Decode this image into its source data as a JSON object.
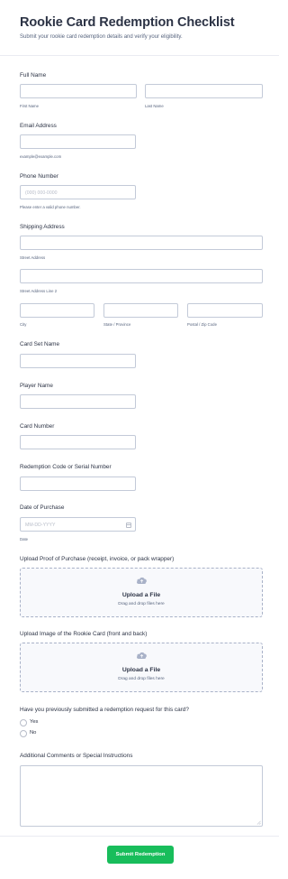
{
  "form": {
    "title": "Rookie Card Redemption Checklist",
    "subtitle": "Submit your rookie card redemption details and verify your eligibility."
  },
  "full_name": {
    "label": "Full Name",
    "first_sub": "First Name",
    "last_sub": "Last Name",
    "first_value": "",
    "last_value": ""
  },
  "email": {
    "label": "Email Address",
    "sub": "example@example.com",
    "value": ""
  },
  "phone": {
    "label": "Phone Number",
    "placeholder": "(000) 000-0000",
    "sub": "Please enter a valid phone number.",
    "value": ""
  },
  "shipping": {
    "label": "Shipping Address",
    "street_sub": "Street Address",
    "street2_sub": "Street Address Line 2",
    "city_sub": "City",
    "state_sub": "State / Province",
    "postal_sub": "Postal / Zip Code"
  },
  "card_set": {
    "label": "Card Set Name",
    "value": ""
  },
  "player": {
    "label": "Player Name",
    "value": ""
  },
  "card_number": {
    "label": "Card Number",
    "value": ""
  },
  "redemption_code": {
    "label": "Redemption Code or Serial Number",
    "value": ""
  },
  "purchase_date": {
    "label": "Date of Purchase",
    "placeholder": "MM-DD-YYYY",
    "sub": "Date",
    "icon": "calendar-icon"
  },
  "upload_proof": {
    "label": "Upload Proof of Purchase (receipt, invoice, or pack wrapper)",
    "title": "Upload a File",
    "sub": "Drag and drop files here",
    "icon": "cloud-upload-icon"
  },
  "upload_card": {
    "label": "Upload Image of the Rookie Card (front and back)",
    "title": "Upload a File",
    "sub": "Drag and drop files here",
    "icon": "cloud-upload-icon"
  },
  "previous_request": {
    "label": "Have you previously submitted a redemption request for this card?",
    "options": [
      "Yes",
      "No"
    ],
    "selected": null
  },
  "comments": {
    "label": "Additional Comments or Special Instructions",
    "value": ""
  },
  "submit_label": "Submit Redemption",
  "colors": {
    "accent": "#18bd5b",
    "text": "#2c3345",
    "muted": "#57647e",
    "border": "#c3cad8",
    "upload_bg": "#f8f9fc"
  }
}
